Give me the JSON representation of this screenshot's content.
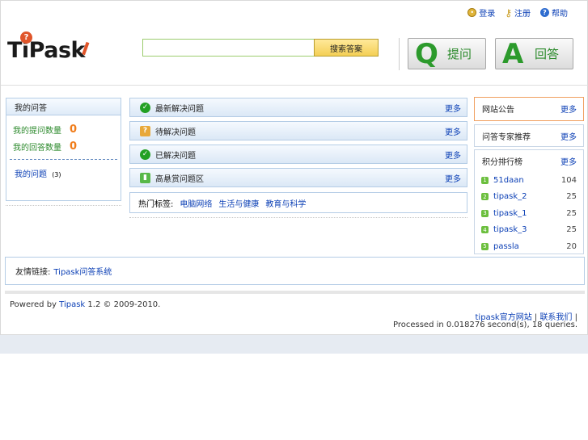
{
  "top_links": [
    {
      "label": "登录",
      "icon": "lock-icon"
    },
    {
      "label": "注册",
      "icon": "key-icon"
    },
    {
      "label": "帮助",
      "icon": "help-icon"
    }
  ],
  "logo": {
    "text": "TiPask",
    "badge": "?"
  },
  "search": {
    "value": "",
    "button_label": "搜索答案"
  },
  "actions": {
    "ask": {
      "letter": "Q",
      "label": "提问"
    },
    "answer": {
      "letter": "A",
      "label": "回答"
    }
  },
  "left_box": {
    "title": "我的问答",
    "stats": [
      {
        "label": "我的提问数量",
        "value": "0"
      },
      {
        "label": "我的回答数量",
        "value": "0"
      }
    ],
    "my_questions": {
      "label": "我的问题",
      "count": "(3)"
    }
  },
  "center_panels": [
    {
      "title": "最新解决问题",
      "more": "更多",
      "icon": "check-icon"
    },
    {
      "title": "待解决问题",
      "more": "更多",
      "icon": "star-icon"
    },
    {
      "title": "已解决问题",
      "more": "更多",
      "icon": "check-icon"
    },
    {
      "title": "高悬赏问题区",
      "more": "更多",
      "icon": "chart-icon"
    }
  ],
  "tags": {
    "label": "热门标签:",
    "items": [
      "电脑网络",
      "生活与健康",
      "教育与科学"
    ]
  },
  "right_boxes": {
    "notice": {
      "title": "网站公告",
      "more": "更多"
    },
    "experts": {
      "title": "问答专家推荐",
      "more": "更多"
    },
    "ranking": {
      "title": "积分排行榜",
      "more": "更多",
      "rows": [
        {
          "rank": "1",
          "name": "51daan",
          "score": "104"
        },
        {
          "rank": "2",
          "name": "tipask_2",
          "score": "25"
        },
        {
          "rank": "3",
          "name": "tipask_1",
          "score": "25"
        },
        {
          "rank": "4",
          "name": "tipask_3",
          "score": "25"
        },
        {
          "rank": "5",
          "name": "passla",
          "score": "20"
        }
      ]
    }
  },
  "friend_links": {
    "label": "友情链接:",
    "link": "Tipask问答系统"
  },
  "footer": {
    "powered_prefix": "Powered by",
    "brand": "Tipask",
    "version": "1.2 © 2009-2010.",
    "links": [
      "tipask官方网站",
      "联系我们"
    ],
    "processed": "Processed in 0.018276 second(s), 18 queries."
  },
  "colors": {
    "accent_green": "#2c9a2c",
    "link_blue": "#0b3fb5",
    "orange": "#f07c1a",
    "panel_border": "#b5cde6"
  }
}
